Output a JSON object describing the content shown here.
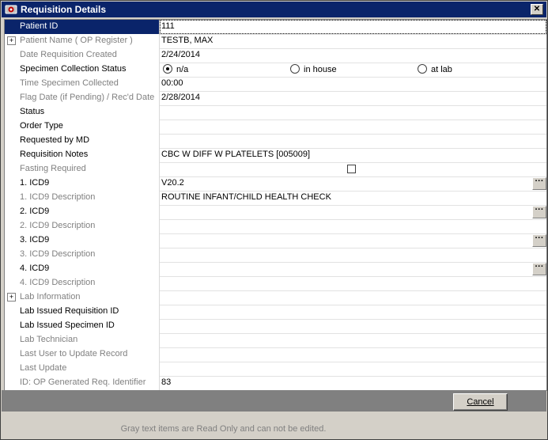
{
  "window": {
    "title": "Requisition Details",
    "close_label": "✕"
  },
  "rows": [
    {
      "label": "Patient ID",
      "value": "111",
      "ro": false,
      "selected": true,
      "focus": true
    },
    {
      "label": "Patient Name ( OP Register )",
      "value": "TESTB, MAX",
      "ro": true,
      "expand": true
    },
    {
      "label": "Date Requisition Created",
      "value": "2/24/2014",
      "ro": true
    },
    {
      "label": "Specimen Collection Status",
      "ro": false,
      "radios": [
        {
          "label": "n/a",
          "checked": true
        },
        {
          "label": "in house",
          "checked": false
        },
        {
          "label": "at lab",
          "checked": false
        }
      ]
    },
    {
      "label": "Time Specimen Collected",
      "value": "00:00",
      "ro": true
    },
    {
      "label": "Flag Date (if Pending) / Rec'd Date",
      "value": "2/28/2014",
      "ro": true
    },
    {
      "label": "Status",
      "value": "",
      "ro": false
    },
    {
      "label": "Order Type",
      "value": "",
      "ro": false
    },
    {
      "label": "Requested by MD",
      "value": "",
      "ro": false
    },
    {
      "label": "Requisition Notes",
      "value": "CBC W DIFF W PLATELETS [005009]",
      "ro": false
    },
    {
      "label": "Fasting Required",
      "ro": true,
      "checkbox": true,
      "checked": false
    },
    {
      "label": "1. ICD9",
      "value": "V20.2",
      "ro": false,
      "dots": true
    },
    {
      "label": "1. ICD9 Description",
      "value": "ROUTINE INFANT/CHILD HEALTH CHECK",
      "ro": true
    },
    {
      "label": "2. ICD9",
      "value": "",
      "ro": false,
      "dots": true
    },
    {
      "label": "2. ICD9 Description",
      "value": "",
      "ro": true
    },
    {
      "label": "3. ICD9",
      "value": "",
      "ro": false,
      "dots": true
    },
    {
      "label": "3. ICD9 Description",
      "value": "",
      "ro": true
    },
    {
      "label": "4. ICD9",
      "value": "",
      "ro": false,
      "dots": true
    },
    {
      "label": "4. ICD9 Description",
      "value": "",
      "ro": true
    },
    {
      "label": "Lab Information",
      "value": "",
      "ro": true,
      "expand": true
    },
    {
      "label": "Lab Issued Requisition ID",
      "value": "",
      "ro": false
    },
    {
      "label": "Lab Issued Specimen ID",
      "value": "",
      "ro": false
    },
    {
      "label": "Lab Technician",
      "value": "",
      "ro": true
    },
    {
      "label": "Last User to Update Record",
      "value": "",
      "ro": true
    },
    {
      "label": "Last Update",
      "value": "",
      "ro": true
    },
    {
      "label": "ID: OP Generated Req. Identifier",
      "value": "83",
      "ro": true
    }
  ],
  "buttons": {
    "cancel_label": "Cancel"
  },
  "footer": {
    "note": "Gray text items are Read Only and can not be edited."
  },
  "colors": {
    "titlebar": "#0a246a",
    "selected": "#0a246a",
    "readonly_text": "#808080"
  }
}
